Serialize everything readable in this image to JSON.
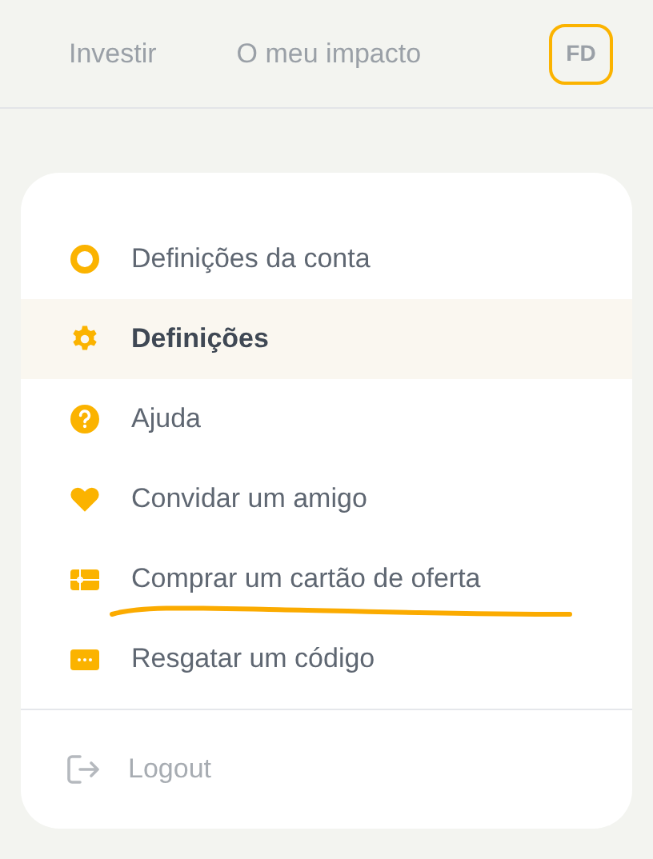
{
  "nav": {
    "links": [
      "Investir",
      "O meu impacto"
    ],
    "avatar": "FD"
  },
  "menu": {
    "items": [
      {
        "label": "Definições da conta",
        "selected": false,
        "underlined": false
      },
      {
        "label": "Definições",
        "selected": true,
        "underlined": false
      },
      {
        "label": "Ajuda",
        "selected": false,
        "underlined": false
      },
      {
        "label": "Convidar um amigo",
        "selected": false,
        "underlined": false
      },
      {
        "label": "Comprar um cartão de oferta",
        "selected": false,
        "underlined": true
      },
      {
        "label": "Resgatar um código",
        "selected": false,
        "underlined": false
      }
    ],
    "logout": "Logout"
  }
}
